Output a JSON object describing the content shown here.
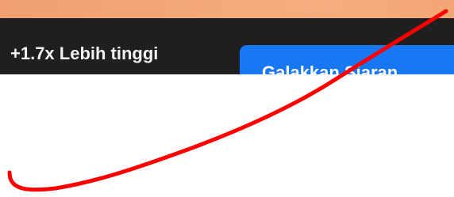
{
  "banner": {
    "boost_text": "+1.7x Lebih tinggi",
    "cta_label": "Galakkan Siaran"
  },
  "colors": {
    "banner_top": "#f3a779",
    "bar_background": "#1f1f1f",
    "button_blue": "#1877f2",
    "annotation_red": "#ff0000"
  }
}
